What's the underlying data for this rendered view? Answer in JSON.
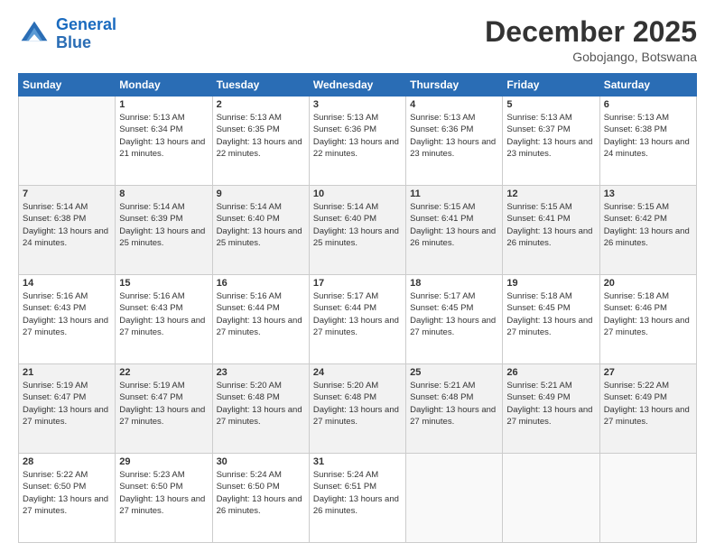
{
  "logo": {
    "line1": "General",
    "line2": "Blue"
  },
  "title": "December 2025",
  "location": "Gobojango, Botswana",
  "days_header": [
    "Sunday",
    "Monday",
    "Tuesday",
    "Wednesday",
    "Thursday",
    "Friday",
    "Saturday"
  ],
  "weeks": [
    [
      {
        "day": "",
        "sunrise": "",
        "sunset": "",
        "daylight": ""
      },
      {
        "day": "1",
        "sunrise": "Sunrise: 5:13 AM",
        "sunset": "Sunset: 6:34 PM",
        "daylight": "Daylight: 13 hours and 21 minutes."
      },
      {
        "day": "2",
        "sunrise": "Sunrise: 5:13 AM",
        "sunset": "Sunset: 6:35 PM",
        "daylight": "Daylight: 13 hours and 22 minutes."
      },
      {
        "day": "3",
        "sunrise": "Sunrise: 5:13 AM",
        "sunset": "Sunset: 6:36 PM",
        "daylight": "Daylight: 13 hours and 22 minutes."
      },
      {
        "day": "4",
        "sunrise": "Sunrise: 5:13 AM",
        "sunset": "Sunset: 6:36 PM",
        "daylight": "Daylight: 13 hours and 23 minutes."
      },
      {
        "day": "5",
        "sunrise": "Sunrise: 5:13 AM",
        "sunset": "Sunset: 6:37 PM",
        "daylight": "Daylight: 13 hours and 23 minutes."
      },
      {
        "day": "6",
        "sunrise": "Sunrise: 5:13 AM",
        "sunset": "Sunset: 6:38 PM",
        "daylight": "Daylight: 13 hours and 24 minutes."
      }
    ],
    [
      {
        "day": "7",
        "sunrise": "Sunrise: 5:14 AM",
        "sunset": "Sunset: 6:38 PM",
        "daylight": "Daylight: 13 hours and 24 minutes."
      },
      {
        "day": "8",
        "sunrise": "Sunrise: 5:14 AM",
        "sunset": "Sunset: 6:39 PM",
        "daylight": "Daylight: 13 hours and 25 minutes."
      },
      {
        "day": "9",
        "sunrise": "Sunrise: 5:14 AM",
        "sunset": "Sunset: 6:40 PM",
        "daylight": "Daylight: 13 hours and 25 minutes."
      },
      {
        "day": "10",
        "sunrise": "Sunrise: 5:14 AM",
        "sunset": "Sunset: 6:40 PM",
        "daylight": "Daylight: 13 hours and 25 minutes."
      },
      {
        "day": "11",
        "sunrise": "Sunrise: 5:15 AM",
        "sunset": "Sunset: 6:41 PM",
        "daylight": "Daylight: 13 hours and 26 minutes."
      },
      {
        "day": "12",
        "sunrise": "Sunrise: 5:15 AM",
        "sunset": "Sunset: 6:41 PM",
        "daylight": "Daylight: 13 hours and 26 minutes."
      },
      {
        "day": "13",
        "sunrise": "Sunrise: 5:15 AM",
        "sunset": "Sunset: 6:42 PM",
        "daylight": "Daylight: 13 hours and 26 minutes."
      }
    ],
    [
      {
        "day": "14",
        "sunrise": "Sunrise: 5:16 AM",
        "sunset": "Sunset: 6:43 PM",
        "daylight": "Daylight: 13 hours and 27 minutes."
      },
      {
        "day": "15",
        "sunrise": "Sunrise: 5:16 AM",
        "sunset": "Sunset: 6:43 PM",
        "daylight": "Daylight: 13 hours and 27 minutes."
      },
      {
        "day": "16",
        "sunrise": "Sunrise: 5:16 AM",
        "sunset": "Sunset: 6:44 PM",
        "daylight": "Daylight: 13 hours and 27 minutes."
      },
      {
        "day": "17",
        "sunrise": "Sunrise: 5:17 AM",
        "sunset": "Sunset: 6:44 PM",
        "daylight": "Daylight: 13 hours and 27 minutes."
      },
      {
        "day": "18",
        "sunrise": "Sunrise: 5:17 AM",
        "sunset": "Sunset: 6:45 PM",
        "daylight": "Daylight: 13 hours and 27 minutes."
      },
      {
        "day": "19",
        "sunrise": "Sunrise: 5:18 AM",
        "sunset": "Sunset: 6:45 PM",
        "daylight": "Daylight: 13 hours and 27 minutes."
      },
      {
        "day": "20",
        "sunrise": "Sunrise: 5:18 AM",
        "sunset": "Sunset: 6:46 PM",
        "daylight": "Daylight: 13 hours and 27 minutes."
      }
    ],
    [
      {
        "day": "21",
        "sunrise": "Sunrise: 5:19 AM",
        "sunset": "Sunset: 6:47 PM",
        "daylight": "Daylight: 13 hours and 27 minutes."
      },
      {
        "day": "22",
        "sunrise": "Sunrise: 5:19 AM",
        "sunset": "Sunset: 6:47 PM",
        "daylight": "Daylight: 13 hours and 27 minutes."
      },
      {
        "day": "23",
        "sunrise": "Sunrise: 5:20 AM",
        "sunset": "Sunset: 6:48 PM",
        "daylight": "Daylight: 13 hours and 27 minutes."
      },
      {
        "day": "24",
        "sunrise": "Sunrise: 5:20 AM",
        "sunset": "Sunset: 6:48 PM",
        "daylight": "Daylight: 13 hours and 27 minutes."
      },
      {
        "day": "25",
        "sunrise": "Sunrise: 5:21 AM",
        "sunset": "Sunset: 6:48 PM",
        "daylight": "Daylight: 13 hours and 27 minutes."
      },
      {
        "day": "26",
        "sunrise": "Sunrise: 5:21 AM",
        "sunset": "Sunset: 6:49 PM",
        "daylight": "Daylight: 13 hours and 27 minutes."
      },
      {
        "day": "27",
        "sunrise": "Sunrise: 5:22 AM",
        "sunset": "Sunset: 6:49 PM",
        "daylight": "Daylight: 13 hours and 27 minutes."
      }
    ],
    [
      {
        "day": "28",
        "sunrise": "Sunrise: 5:22 AM",
        "sunset": "Sunset: 6:50 PM",
        "daylight": "Daylight: 13 hours and 27 minutes."
      },
      {
        "day": "29",
        "sunrise": "Sunrise: 5:23 AM",
        "sunset": "Sunset: 6:50 PM",
        "daylight": "Daylight: 13 hours and 27 minutes."
      },
      {
        "day": "30",
        "sunrise": "Sunrise: 5:24 AM",
        "sunset": "Sunset: 6:50 PM",
        "daylight": "Daylight: 13 hours and 26 minutes."
      },
      {
        "day": "31",
        "sunrise": "Sunrise: 5:24 AM",
        "sunset": "Sunset: 6:51 PM",
        "daylight": "Daylight: 13 hours and 26 minutes."
      },
      {
        "day": "",
        "sunrise": "",
        "sunset": "",
        "daylight": ""
      },
      {
        "day": "",
        "sunrise": "",
        "sunset": "",
        "daylight": ""
      },
      {
        "day": "",
        "sunrise": "",
        "sunset": "",
        "daylight": ""
      }
    ]
  ]
}
